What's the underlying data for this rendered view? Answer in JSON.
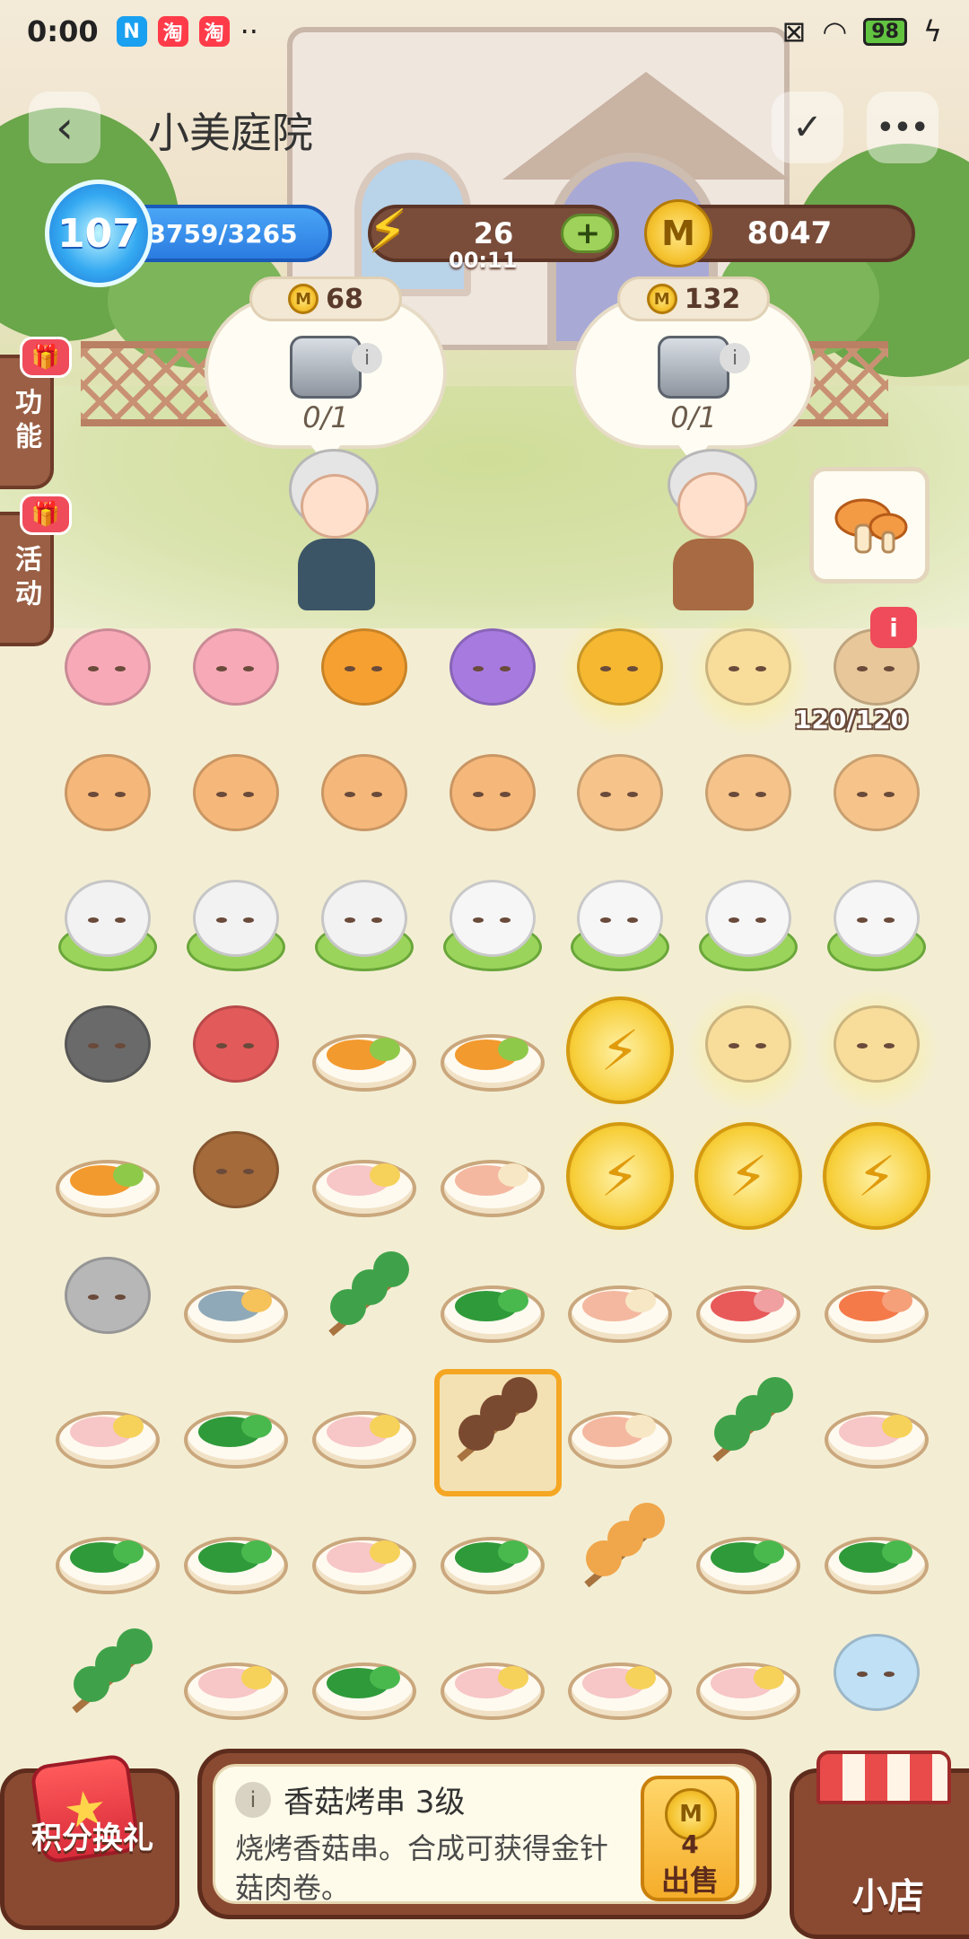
{
  "status_bar": {
    "time": "0:00",
    "battery": "98",
    "app_icons": [
      "N",
      "淘",
      "淘"
    ],
    "more": "··"
  },
  "title_bar": {
    "back_icon": "chevron-left-icon",
    "title": "小美庭院",
    "more_label": "•••"
  },
  "resources": {
    "level": "107",
    "xp": "53759/3265",
    "energy": "26",
    "energy_timer": "00:11",
    "coins": "8047"
  },
  "side_tabs": {
    "functions": "功能",
    "activities": "活动"
  },
  "orders": [
    {
      "price": "68",
      "count": "0/1",
      "item_icon": "stone-lantern-icon"
    },
    {
      "price": "132",
      "count": "0/1",
      "item_icon": "stone-stove-icon"
    }
  ],
  "generator": {
    "counter": "120/120",
    "info_badge": "i"
  },
  "board": {
    "rows": [
      [
        "pink-sheep",
        "pink-sheep",
        "owl-tuxedo",
        "purple-cat",
        "golden-lantern",
        "golden-bunny",
        "gift-box"
      ],
      [
        "tea-pot-chick-glasses",
        "tea-pot-chick-glasses",
        "tea-pot-chick",
        "tea-pot-chick",
        "tea-bowl-chick",
        "tea-bowl-chick",
        "tea-bowl-chick"
      ],
      [
        "sailor-dog-cabbage",
        "sleepy-dog-cabbage",
        "sleepy-dog-cabbage",
        "white-cat-cabbage",
        "white-cat-cabbage",
        "white-cat-cabbage",
        "white-cat-cabbage"
      ],
      [
        "bbq-grill",
        "soda-crate",
        "omelette-plate",
        "omelette-plate",
        "energy-coin",
        "golden-bunny",
        "golden-bunny"
      ],
      [
        "omelette-plate",
        "puppy",
        "dumpling-plate",
        "shrimp-plate",
        "energy-coin",
        "energy-coin",
        "energy-coin"
      ],
      [
        "cat-pot",
        "fish-plate",
        "chive-skewer",
        "spinach-plate",
        "shrimp-plate",
        "sausage-plate",
        "salmon-plate"
      ],
      [
        "dumpling-plate",
        "spinach-plate",
        "dumpling-plate",
        "mushroom-skewer",
        "shrimp-plate",
        "chive-skewer",
        "dumpling-plate"
      ],
      [
        "spinach-plate",
        "spinach-plate",
        "dumpling-plate",
        "spinach-plate",
        "meat-skewer",
        "spinach-plate",
        "spinach-plate"
      ],
      [
        "chive-skewer",
        "dumpling-plate",
        "spinach-plate",
        "dumpling-plate",
        "dumpling-plate",
        "dumpling-plate",
        "cloth-basket"
      ]
    ],
    "selected": {
      "row": 6,
      "col": 3
    }
  },
  "item_info": {
    "icon": "info-icon",
    "title": "香菇烤串 3级",
    "description": "烧烤香菇串。合成可获得金针菇肉卷。",
    "sell_price": "4",
    "sell_label": "出售"
  },
  "bottom_buttons": {
    "exchange": "积分换礼",
    "shop": "小店"
  },
  "colors": {
    "wood": "#8a4a32",
    "coin": "#f5c330",
    "energy": "#ffd429",
    "xp": "#2b7be0"
  }
}
